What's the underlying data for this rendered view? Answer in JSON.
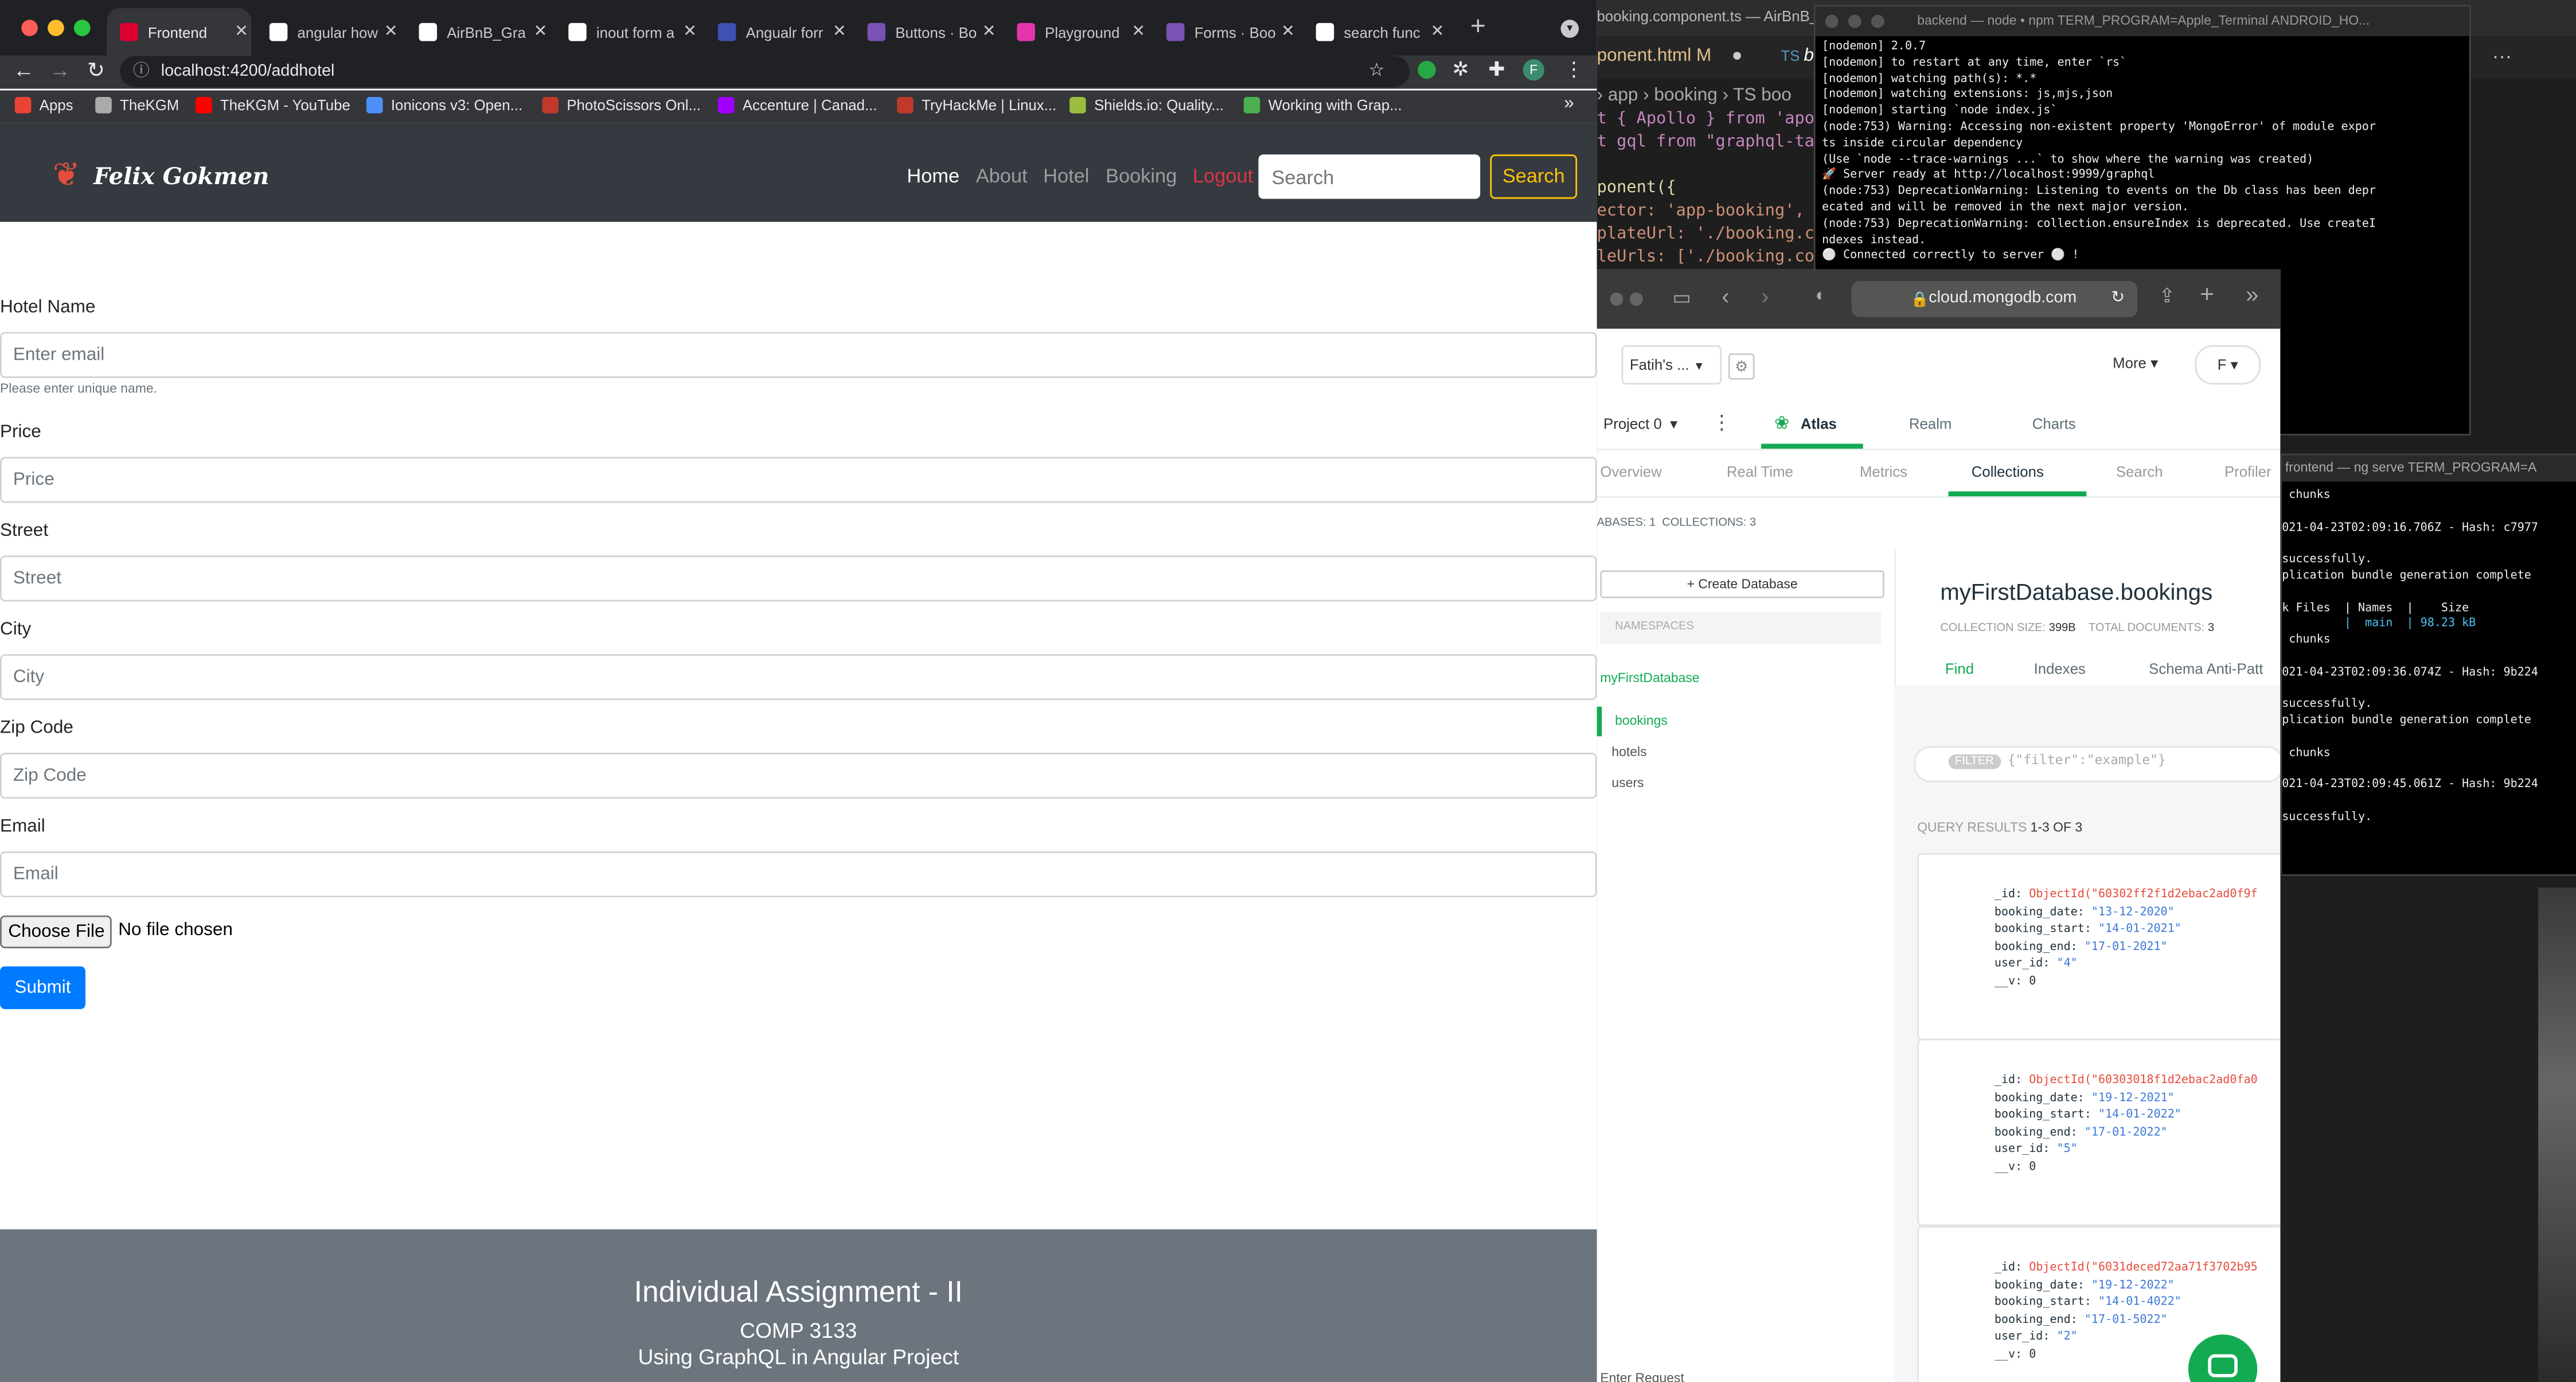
{
  "browser": {
    "tabs": [
      {
        "label": "Frontend",
        "icon": "angular-icon",
        "active": true
      },
      {
        "label": "angular how",
        "icon": "google-icon"
      },
      {
        "label": "AirBnB_Gra",
        "icon": "github-icon"
      },
      {
        "label": "inout form a",
        "icon": "google-icon"
      },
      {
        "label": "Angualr forr",
        "icon": "angular-form-icon"
      },
      {
        "label": "Buttons · Bo",
        "icon": "bootstrap-icon"
      },
      {
        "label": "Playground",
        "icon": "graphql-icon"
      },
      {
        "label": "Forms · Boo",
        "icon": "bootstrap-icon"
      },
      {
        "label": "search func",
        "icon": "google-icon"
      }
    ],
    "url": "localhost:4200/addhotel",
    "profile_initial": "F",
    "bookmarks": [
      {
        "label": "Apps",
        "color": "#ea4335"
      },
      {
        "label": "TheKGM",
        "color": "#aaaaaa"
      },
      {
        "label": "TheKGM - YouTube",
        "color": "#ff0000"
      },
      {
        "label": "Ionicons v3: Open...",
        "color": "#4f8ef7"
      },
      {
        "label": "PhotoScissors Onl...",
        "color": "#c0392b"
      },
      {
        "label": "Accenture | Canad...",
        "color": "#a100ff"
      },
      {
        "label": "TryHackMe | Linux...",
        "color": "#c0392b"
      },
      {
        "label": "Shields.io: Quality...",
        "color": "#9bbe3c"
      },
      {
        "label": "Working with Grap...",
        "color": "#4caf50"
      }
    ]
  },
  "site": {
    "brand": "Felix Gokmen",
    "nav": [
      "Home",
      "About",
      "Hotel",
      "Booking",
      "Logout"
    ],
    "search_placeholder": "Search",
    "search_button": "Search"
  },
  "form": {
    "fields": [
      {
        "label": "Hotel Name",
        "placeholder": "Enter email",
        "help": "Please enter unique name."
      },
      {
        "label": "Price",
        "placeholder": "Price"
      },
      {
        "label": "Street",
        "placeholder": "Street"
      },
      {
        "label": "City",
        "placeholder": "City"
      },
      {
        "label": "Zip Code",
        "placeholder": "Zip Code"
      },
      {
        "label": "Email",
        "placeholder": "Email"
      }
    ],
    "file_button": "Choose File",
    "file_status": "No file chosen",
    "submit": "Submit"
  },
  "footer": {
    "title": "Individual Assignment - II",
    "course": "COMP 3133",
    "subtitle": "Using GraphQL in Angular Project"
  },
  "vscode": {
    "window_title": "booking.component.ts — AirBnB_",
    "tab1": "ponent.html M",
    "tab2_prefix": "TS",
    "tab2": "b",
    "breadcrumb": "› app › booking › TS boo",
    "code": [
      "t { Apollo } from 'apo",
      "t gql from \"graphql-ta",
      "",
      "ponent({",
      "ector: 'app-booking',",
      "plateUrl: './booking.co",
      "leUrls: ['./booking.co"
    ]
  },
  "terminal_backend": {
    "title": "backend — node • npm TERM_PROGRAM=Apple_Terminal ANDROID_HO...",
    "lines": [
      "[nodemon] 2.0.7",
      "[nodemon] to restart at any time, enter `rs`",
      "[nodemon] watching path(s): *.*",
      "[nodemon] watching extensions: js,mjs,json",
      "[nodemon] starting `node index.js`",
      "(node:753) Warning: Accessing non-existent property 'MongoError' of module expor",
      "ts inside circular dependency",
      "(Use `node --trace-warnings ...` to show where the warning was created)",
      "🚀 Server ready at http://localhost:9999/graphql",
      "(node:753) DeprecationWarning: Listening to events on the Db class has been depr",
      "ecated and will be removed in the next major version.",
      "(node:753) DeprecationWarning: collection.ensureIndex is deprecated. Use createI",
      "ndexes instead.",
      "⚪ Connected correctly to server ⚪ !"
    ]
  },
  "mongodb": {
    "url": "cloud.mongodb.com",
    "org": "Fatih's ...",
    "more": "More",
    "user": "F",
    "project": "Project 0",
    "tabs": [
      "Atlas",
      "Realm",
      "Charts"
    ],
    "subtabs": [
      "Overview",
      "Real Time",
      "Metrics",
      "Collections",
      "Search",
      "Profiler"
    ],
    "stats": "ABASES: 1  COLLECTIONS: 3",
    "create_db": "+ Create Database",
    "namespaces": "NAMESPACES",
    "database": "myFirstDatabase",
    "collections": [
      "bookings",
      "hotels",
      "users"
    ],
    "collection_title": "myFirstDatabase.bookings",
    "collection_size_label": "COLLECTION SIZE:",
    "collection_size": "399B",
    "total_docs_label": "TOTAL DOCUMENTS:",
    "total_docs": "3",
    "coll_tabs": [
      "Find",
      "Indexes",
      "Schema Anti-Patt"
    ],
    "filter_tag": "FILTER",
    "filter_text": "{\"filter\":\"example\"}",
    "results_label": "QUERY RESULTS",
    "results_count": "1-3 OF 3",
    "documents": [
      {
        "id": "ObjectId(\"60302ff2f1d2ebac2ad0f9f",
        "booking_date": "\"13-12-2020\"",
        "booking_start": "\"14-01-2021\"",
        "booking_end": "\"17-01-2021\"",
        "user_id": "\"4\"",
        "v": "0"
      },
      {
        "id": "ObjectId(\"60303018f1d2ebac2ad0fa0",
        "booking_date": "\"19-12-2021\"",
        "booking_start": "\"14-01-2022\"",
        "booking_end": "\"17-01-2022\"",
        "user_id": "\"5\"",
        "v": "0"
      },
      {
        "id": "ObjectId(\"6031deced72aa71f3702b95",
        "booking_date": "\"19-12-2022\"",
        "booking_start": "\"14-01-4022\"",
        "booking_end": "\"17-01-5022\"",
        "user_id": "\"2\"",
        "v": "0"
      }
    ],
    "bottom_text": "Enter Request"
  },
  "terminal_frontend": {
    "title": "frontend — ng serve TERM_PROGRAM=A",
    "lines": [
      " chunks",
      "",
      "021-04-23T02:09:16.706Z - Hash: c7977",
      "",
      "successfully.",
      "plication bundle generation complete",
      "",
      "k Files  | Names  |    Size",
      "         |  main  | 98.23 kB",
      " chunks",
      "",
      "021-04-23T02:09:36.074Z - Hash: 9b224",
      "",
      "successfully.",
      "plication bundle generation complete",
      "",
      " chunks",
      "",
      "021-04-23T02:09:45.061Z - Hash: 9b224",
      "",
      "successfully."
    ]
  },
  "colors": {
    "bootstrap_primary": "#007bff",
    "navbar_dark": "#343a40",
    "footer_gray": "#6c757d",
    "atlas_green": "#13aa52",
    "logout_red": "#dc3545",
    "search_yellow": "#ffc107"
  }
}
